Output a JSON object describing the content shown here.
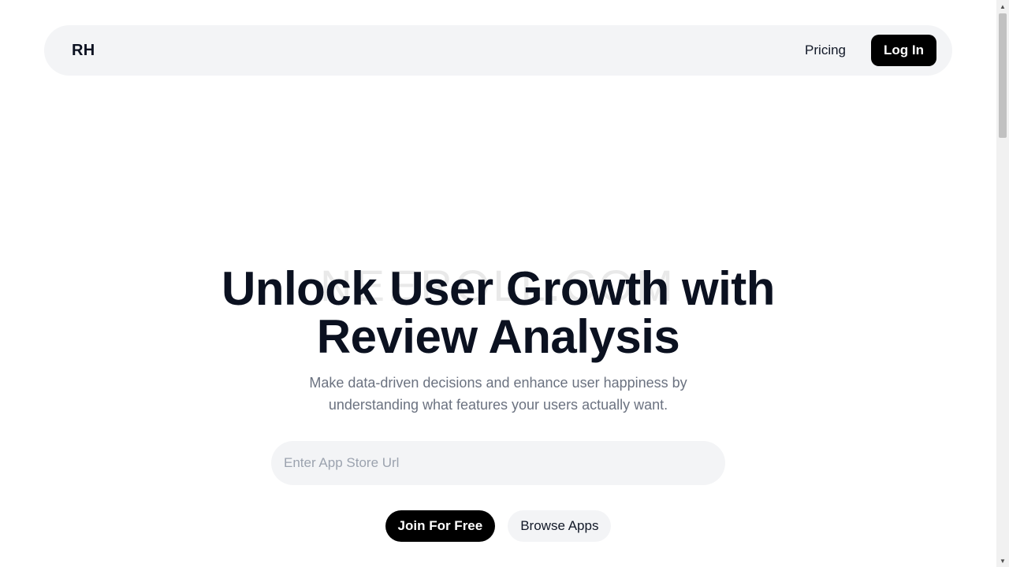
{
  "nav": {
    "logo": "RH",
    "pricing_label": "Pricing",
    "login_label": "Log In"
  },
  "hero": {
    "watermark": "NEEROLL.COM",
    "title_line1": "Unlock User Growth with",
    "title_line2": "Review Analysis",
    "subtitle_line1": "Make data-driven decisions and enhance user happiness by",
    "subtitle_line2": "understanding what features your users actually want.",
    "url_placeholder": "Enter App Store Url",
    "url_value": "",
    "join_label": "Join For Free",
    "browse_label": "Browse Apps"
  },
  "scrollbar": {
    "up_icon": "▲",
    "down_icon": "▼"
  },
  "colors": {
    "accent": "#000000",
    "surface": "#f3f4f6",
    "heading": "#0b1120",
    "muted": "#6b7280"
  }
}
